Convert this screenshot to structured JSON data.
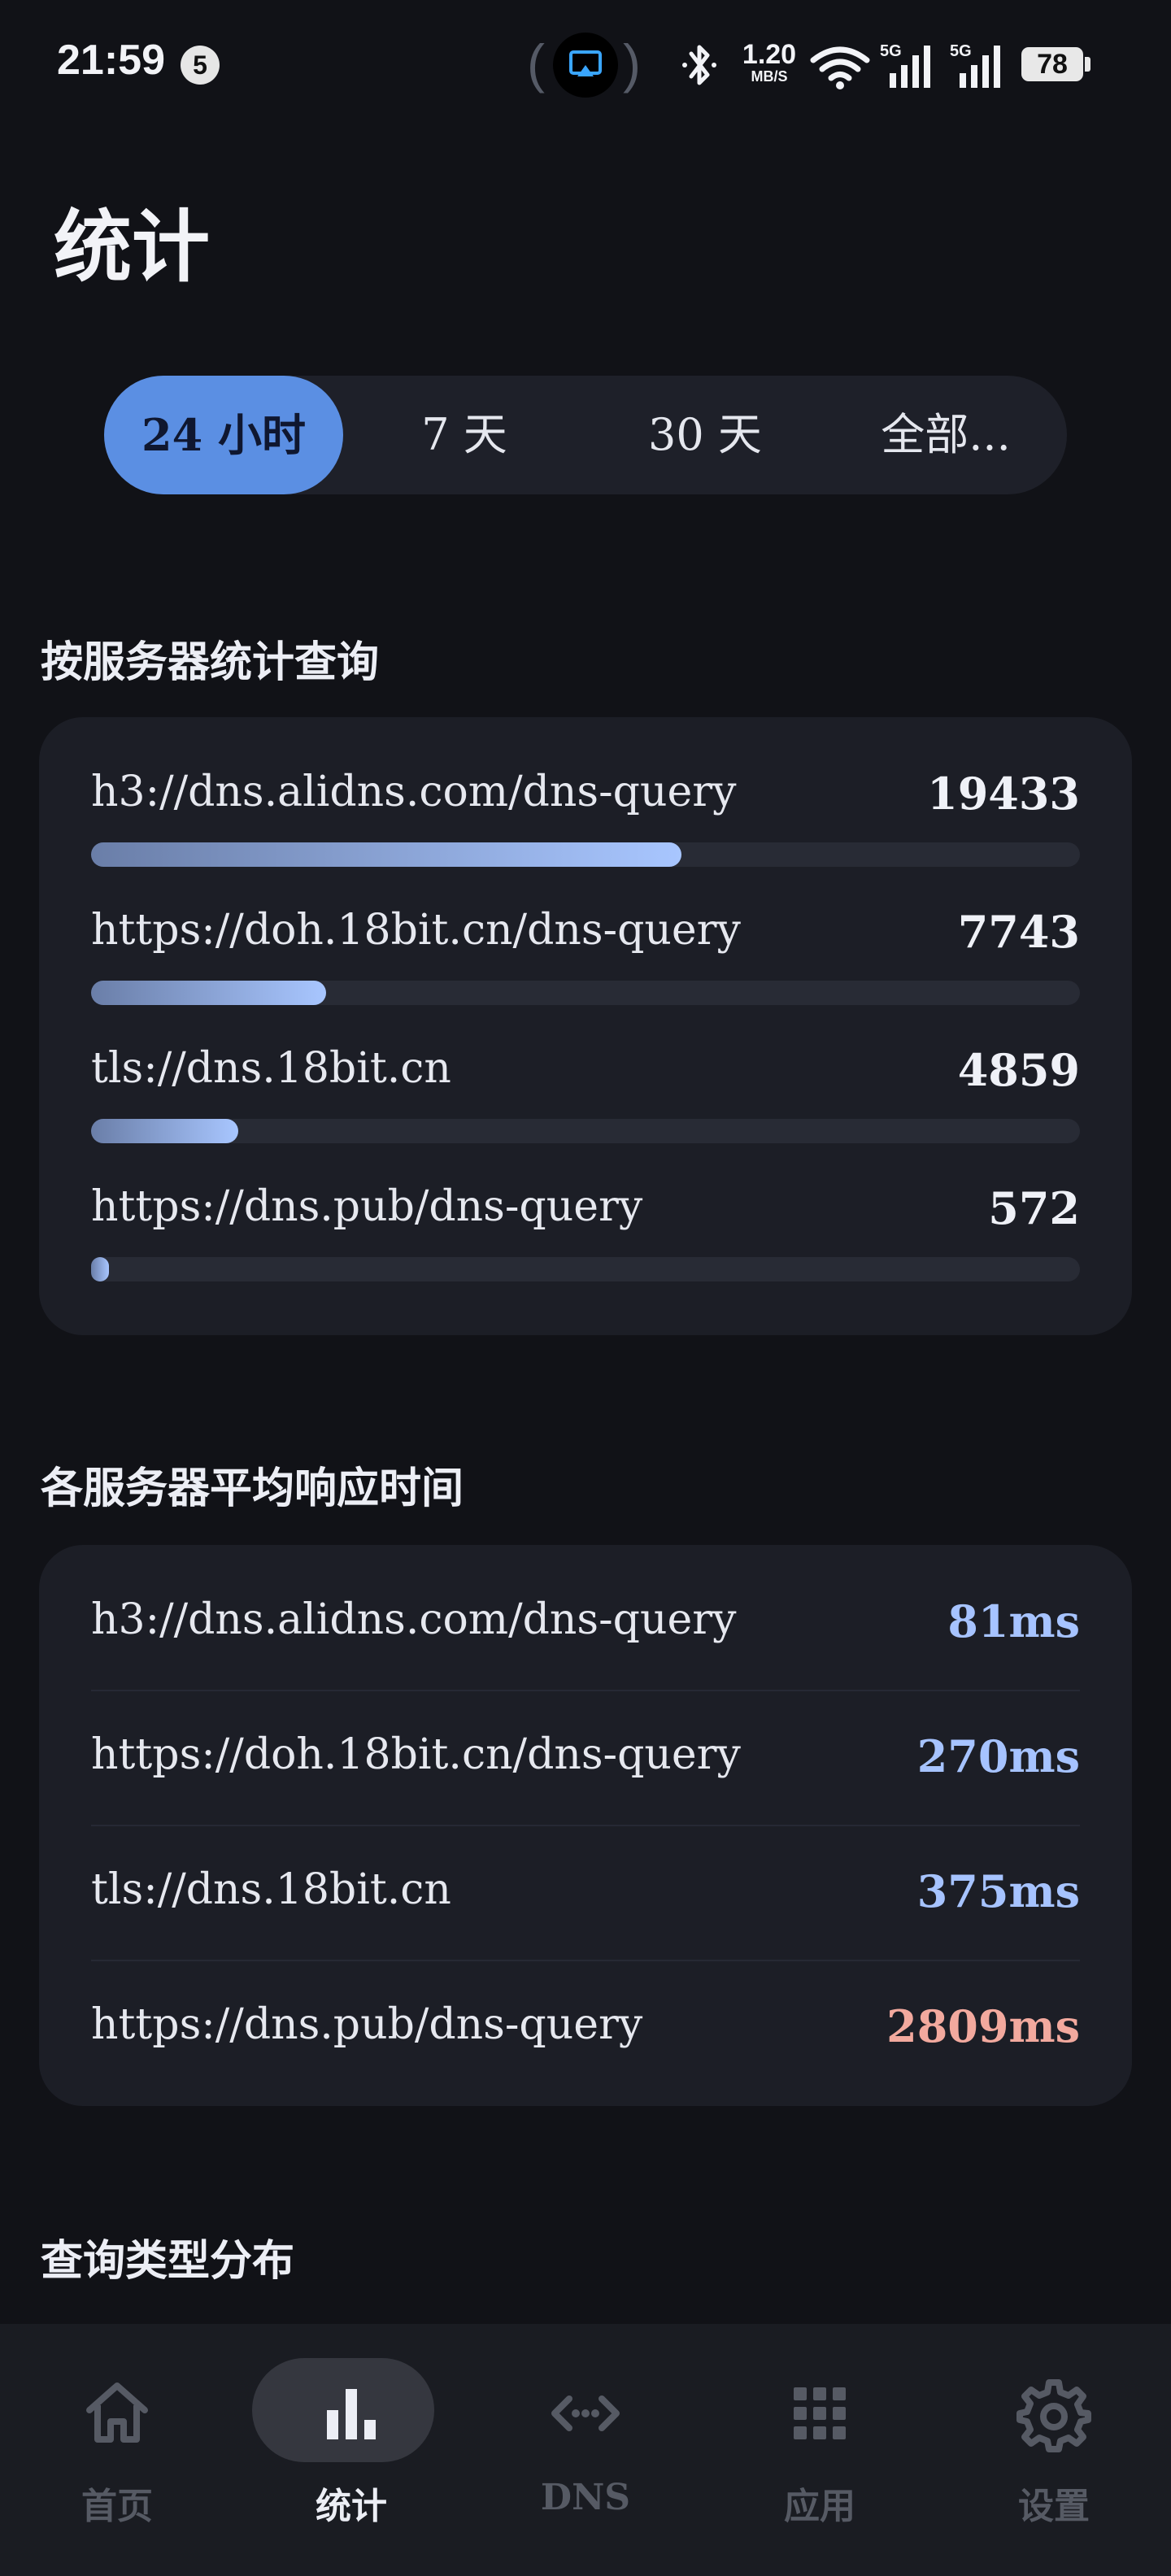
{
  "status_bar": {
    "time": "21:59",
    "notification_count": "5",
    "net_speed_value": "1.20",
    "net_speed_unit": "MB/S",
    "sim1_label": "5G",
    "sim2_label": "5G",
    "battery": "78"
  },
  "page": {
    "title": "统计"
  },
  "time_range": {
    "options": [
      "24 小时",
      "7 天",
      "30 天",
      "全部..."
    ],
    "selected": "24 小时"
  },
  "queries_by_server": {
    "title": "按服务器统计查询",
    "max": 19433,
    "rows": [
      {
        "name": "h3://dns.alidns.com/dns-query",
        "value": "19433",
        "fraction": 0.597
      },
      {
        "name": "https://doh.18bit.cn/dns-query",
        "value": "7743",
        "fraction": 0.238
      },
      {
        "name": "tls://dns.18bit.cn",
        "value": "4859",
        "fraction": 0.149
      },
      {
        "name": "https://dns.pub/dns-query",
        "value": "572",
        "fraction": 0.018
      }
    ]
  },
  "avg_response": {
    "title": "各服务器平均响应时间",
    "rows": [
      {
        "name": "h3://dns.alidns.com/dns-query",
        "value": "81ms",
        "status": "normal"
      },
      {
        "name": "https://doh.18bit.cn/dns-query",
        "value": "270ms",
        "status": "normal"
      },
      {
        "name": "tls://dns.18bit.cn",
        "value": "375ms",
        "status": "normal"
      },
      {
        "name": "https://dns.pub/dns-query",
        "value": "2809ms",
        "status": "slow"
      }
    ]
  },
  "query_types": {
    "title": "查询类型分布"
  },
  "bottom_nav": {
    "items": [
      {
        "label": "首页",
        "icon": "home-icon"
      },
      {
        "label": "统计",
        "icon": "bar-chart-icon"
      },
      {
        "label": "DNS",
        "icon": "code-arrows-icon"
      },
      {
        "label": "应用",
        "icon": "grid-icon"
      },
      {
        "label": "设置",
        "icon": "gear-icon"
      }
    ],
    "selected": "统计"
  },
  "colors": {
    "background": "#111217",
    "card": "#1c1e26",
    "accent": "#5b8fe3",
    "latency_normal": "#a6c3ff",
    "latency_slow": "#f2a99e"
  }
}
